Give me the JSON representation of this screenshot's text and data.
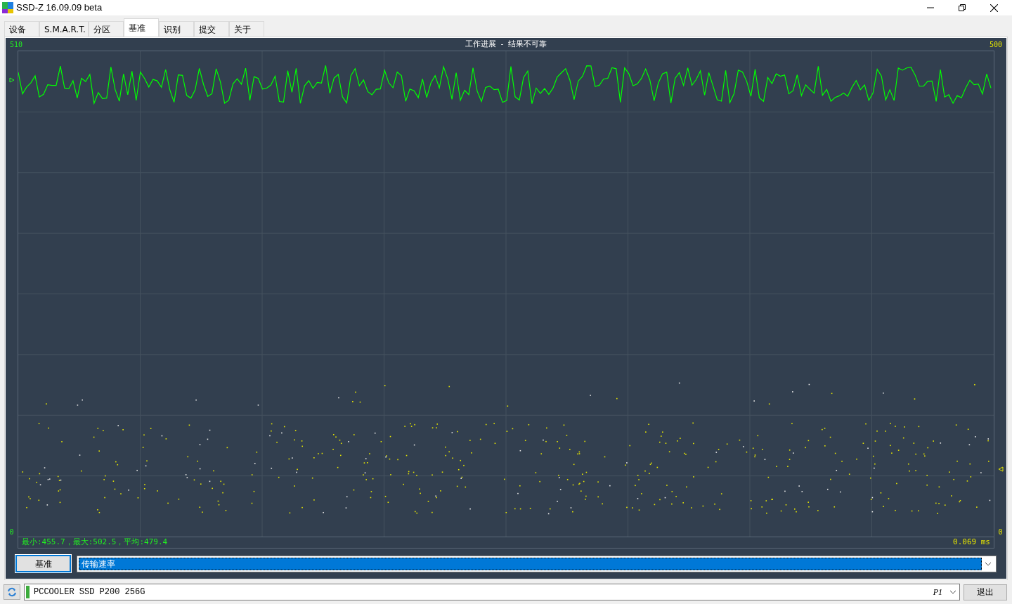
{
  "window": {
    "title": "SSD-Z 16.09.09 beta"
  },
  "tabs": [
    {
      "label": "设备",
      "selected": false
    },
    {
      "label": "S.M.A.R.T.",
      "selected": false
    },
    {
      "label": "分区",
      "selected": false
    },
    {
      "label": "基准",
      "selected": true
    },
    {
      "label": "识别",
      "selected": false
    },
    {
      "label": "提交",
      "selected": false
    },
    {
      "label": "关于",
      "selected": false
    }
  ],
  "chart": {
    "title": "工作进展  -  结果不可靠",
    "left_axis_max": "510",
    "left_axis_min": "0",
    "right_axis_max": "500",
    "right_axis_min": "0",
    "stats": "最小:455.7，最大:502.5，平均:479.4",
    "latency": "0.069 ms"
  },
  "controls": {
    "button": "基准",
    "mode": "传输速率"
  },
  "status_bar": {
    "drive": "PCCOOLER SSD P200 256G",
    "partition": "P1",
    "exit_button": "退出"
  }
}
